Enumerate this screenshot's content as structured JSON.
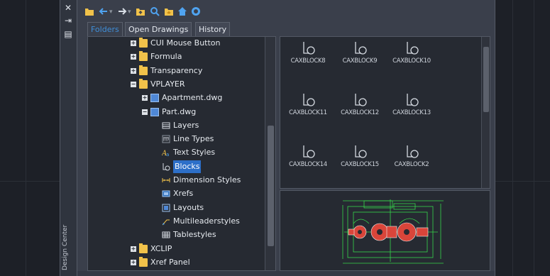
{
  "palette": {
    "title": "Design Center",
    "side_buttons": [
      {
        "name": "close-icon",
        "glyph": "✕"
      },
      {
        "name": "autohide-icon",
        "glyph": "⇥"
      },
      {
        "name": "properties-icon",
        "glyph": "▤"
      }
    ]
  },
  "toolbar": {
    "buttons": [
      {
        "name": "load-icon"
      },
      {
        "name": "back-icon"
      },
      {
        "name": "forward-icon"
      },
      {
        "name": "up-icon"
      },
      {
        "name": "search-icon"
      },
      {
        "name": "favorites-icon"
      },
      {
        "name": "home-icon"
      },
      {
        "name": "tree-view-toggle-icon"
      }
    ]
  },
  "tabs": [
    {
      "label": "Folders",
      "active": true
    },
    {
      "label": "Open Drawings",
      "active": false
    },
    {
      "label": "History",
      "active": false
    }
  ],
  "tree": [
    {
      "label": "CUI Mouse Button",
      "level": 0,
      "expander": "+",
      "icon": "folder"
    },
    {
      "label": "Formula",
      "level": 0,
      "expander": "+",
      "icon": "folder"
    },
    {
      "label": "Transparency",
      "level": 0,
      "expander": "+",
      "icon": "folder"
    },
    {
      "label": "VPLAYER",
      "level": 0,
      "expander": "−",
      "icon": "folder"
    },
    {
      "label": "Apartment.dwg",
      "level": 1,
      "expander": "+",
      "icon": "dwg"
    },
    {
      "label": "Part.dwg",
      "level": 1,
      "expander": "−",
      "icon": "dwg"
    },
    {
      "label": "Layers",
      "level": 2,
      "icon": "layers"
    },
    {
      "label": "Line Types",
      "level": 2,
      "icon": "linetypes"
    },
    {
      "label": "Text Styles",
      "level": 2,
      "icon": "textstyles"
    },
    {
      "label": "Blocks",
      "level": 2,
      "icon": "blocks",
      "selected": true
    },
    {
      "label": "Dimension Styles",
      "level": 2,
      "icon": "dimstyles"
    },
    {
      "label": "Xrefs",
      "level": 2,
      "icon": "xrefs"
    },
    {
      "label": "Layouts",
      "level": 2,
      "icon": "layouts"
    },
    {
      "label": "Multileaderstyles",
      "level": 2,
      "icon": "multileader"
    },
    {
      "label": "Tablestyles",
      "level": 2,
      "icon": "tablestyles"
    },
    {
      "label": "XCLIP",
      "level": 0,
      "expander": "+",
      "icon": "folder"
    },
    {
      "label": "Xref Panel",
      "level": 0,
      "expander": "+",
      "icon": "folder"
    }
  ],
  "blocks": [
    "CAXBLOCK8",
    "CAXBLOCK9",
    "CAXBLOCK10",
    "CAXBLOCK11",
    "CAXBLOCK12",
    "CAXBLOCK13",
    "CAXBLOCK14",
    "CAXBLOCK15",
    "CAXBLOCK2"
  ],
  "colors": {
    "accent": "#2d6fc8",
    "folder": "#f1c24a",
    "preview_lines": "#37d64a",
    "preview_parts": "#d9453a"
  }
}
